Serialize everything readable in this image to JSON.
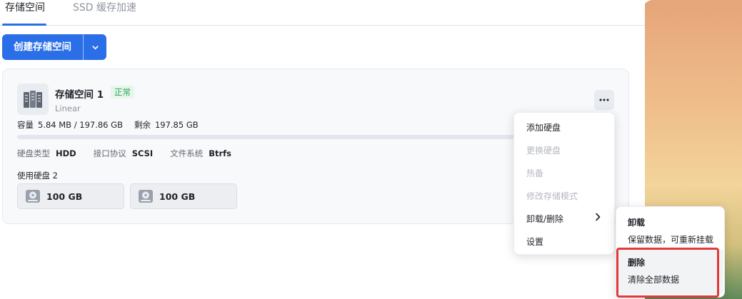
{
  "tabs": [
    {
      "label": "存储空间",
      "active": true
    },
    {
      "label": "SSD 缓存加速",
      "active": false
    }
  ],
  "toolbar": {
    "create_label": "创建存储空间"
  },
  "colors": {
    "accent": "#2a6fe8",
    "ok": "#2ea65a",
    "danger": "#e23a3a"
  },
  "pool": {
    "name": "存储空间 1",
    "status": "正常",
    "mode": "Linear",
    "capacity_label": "容量",
    "capacity_value": "5.84 MB / 197.86 GB",
    "remaining_label": "剩余",
    "remaining_value": "197.85 GB",
    "usage_fraction": 0.0,
    "disk_type_label": "硬盘类型",
    "disk_type": "HDD",
    "interface_label": "接口协议",
    "interface": "SCSI",
    "fs_label": "文件系统",
    "fs": "Btrfs",
    "disks_label": "使用硬盘 2",
    "disks": [
      {
        "size": "100 GB"
      },
      {
        "size": "100 GB"
      }
    ],
    "more_icon": "ellipsis-icon"
  },
  "menu": {
    "items": [
      {
        "label": "添加硬盘",
        "enabled": true
      },
      {
        "label": "更换硬盘",
        "enabled": false
      },
      {
        "label": "热备",
        "enabled": false
      },
      {
        "label": "修改存储模式",
        "enabled": false
      },
      {
        "label": "卸载/删除",
        "enabled": true
      },
      {
        "label": "设置",
        "enabled": true
      }
    ]
  },
  "submenu": {
    "unmount_title": "卸载",
    "unmount_desc": "保留数据，可重新挂载",
    "delete_title": "删除",
    "delete_desc": "清除全部数据"
  }
}
